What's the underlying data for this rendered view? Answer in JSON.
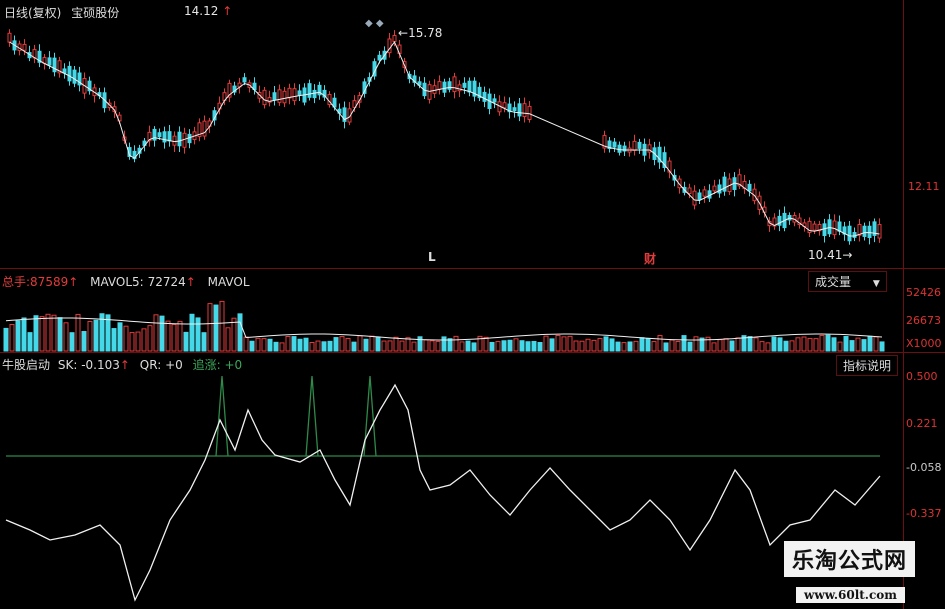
{
  "price_panel": {
    "chart_type": "日线(复权)",
    "stock_name": "宝硕股份",
    "last_price": "14.12",
    "last_arrow": "↑",
    "high_label": "15.78",
    "low_label": "10.41",
    "axis_price": "12.11",
    "marker_L": "L",
    "marker_cai": "财"
  },
  "volume_panel": {
    "total_label": "总手:",
    "total_value": "87589",
    "mavol5_label": "MAVOL5:",
    "mavol5_value": "72724",
    "mavol10_label": "MAVOL",
    "dropdown_label": "成交量",
    "axis": [
      "52426",
      "26673",
      "X1000"
    ]
  },
  "indicator_panel": {
    "name": "牛股启动",
    "sk_label": "SK:",
    "sk_value": "-0.103",
    "qr_label": "QR:",
    "qr_value": "+0",
    "zz_label": "追涨:",
    "zz_value": "+0",
    "button_label": "指标说明",
    "axis": [
      "0.500",
      "0.221",
      "-0.058",
      "-0.337"
    ]
  },
  "watermark": {
    "name": "乐淘公式网",
    "url": "www.60lt.com"
  },
  "colors": {
    "up": "#e23b3b",
    "down": "#45d8e8",
    "ma": "#f0f0f0",
    "signal": "#2f8a4a",
    "grid": "#6b1010"
  }
}
